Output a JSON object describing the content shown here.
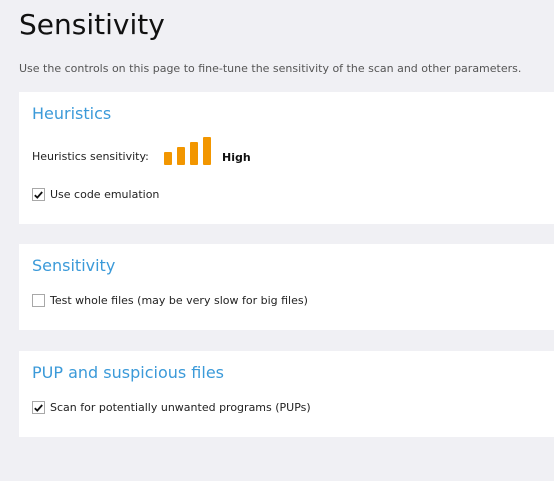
{
  "page": {
    "title": "Sensitivity",
    "subtitle": "Use the controls on this page to fine-tune the sensitivity of the scan and other parameters."
  },
  "sections": {
    "heuristics": {
      "title": "Heuristics",
      "sensitivity_label": "Heuristics sensitivity:",
      "sensitivity_value": "High",
      "sensitivity_level": 4,
      "sensitivity_max": 4,
      "bar_color": "#f29600",
      "code_emulation": {
        "label": "Use code emulation",
        "checked": true
      }
    },
    "sensitivity": {
      "title": "Sensitivity",
      "test_whole_files": {
        "label": "Test whole files (may be very slow for big files)",
        "checked": false
      }
    },
    "pup": {
      "title": "PUP and suspicious files",
      "scan_pups": {
        "label": "Scan for potentially unwanted programs (PUPs)",
        "checked": true
      }
    }
  },
  "colors": {
    "accent": "#3b9ad9",
    "background": "#f0f0f4",
    "card": "#ffffff"
  }
}
